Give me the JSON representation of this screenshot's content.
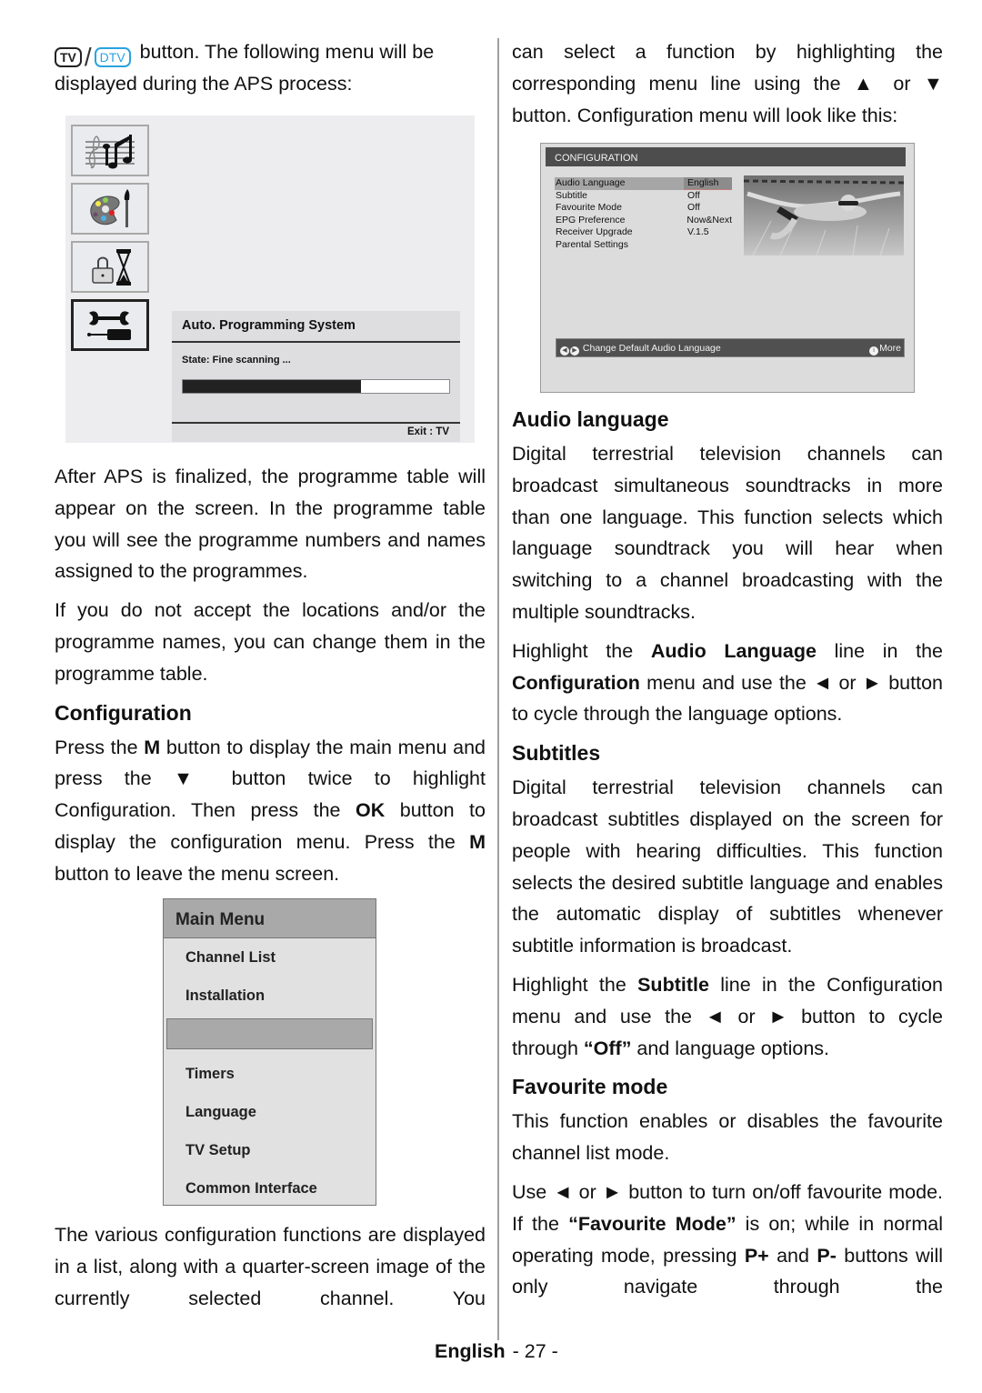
{
  "page": {
    "footer_language": "English",
    "footer_page": "- 27 -"
  },
  "left_column": {
    "intro_keys": {
      "tv": "TV",
      "slash": "/",
      "dtv": "DTV"
    },
    "intro_text": "button.  The following menu will be displayed during the APS process:",
    "aps_screen": {
      "icons": [
        "music-icon",
        "palette-icon",
        "lock-timer-icon",
        "tools-icon"
      ],
      "active_icon_index": 3,
      "dialog_title": "Auto. Programming System",
      "state_text": "State: Fine scanning ...",
      "progress_percent": 67,
      "exit_hint": "Exit : TV"
    },
    "para_after_aps": " After APS is finalized, the programme table will appear on the screen. In the programme table you will see the programme numbers and names assigned to the programmes.",
    "para_locations": "If you do not accept the locations and/or the programme names, you can change them in the programme table.",
    "config_heading": "Configuration",
    "config_para": {
      "t1": "Press the ",
      "b1": "M",
      "t2": " button to display the main menu and press the ▼ button twice to highlight Configuration. Then press the ",
      "b2": "OK",
      "t3": " button to display the configuration menu. Press the ",
      "b3": "M",
      "t4": " button to leave the menu screen."
    },
    "main_menu": {
      "title": "Main Menu",
      "items": [
        "Channel List",
        "Installation",
        "",
        "Timers",
        "Language",
        "TV Setup",
        "Common Interface"
      ],
      "selected_index": 2
    },
    "para_various": "The various configuration functions are displayed in a list, along with a quarter-screen image of the currently selected channel. You"
  },
  "right_column": {
    "para_select": "can select a function by highlighting the corresponding menu line using the ▲ or ▼ button. Configuration menu will look like this:",
    "config_screen": {
      "title": "CONFIGURATION",
      "rows": [
        {
          "label": "Audio Language",
          "value": "English"
        },
        {
          "label": "Subtitle",
          "value": "Off"
        },
        {
          "label": "Favourite Mode",
          "value": "Off"
        },
        {
          "label": "EPG Preference",
          "value": "Now&Next"
        },
        {
          "label": "Receiver Upgrade",
          "value": "V.1.5"
        },
        {
          "label": "Parental Settings",
          "value": ""
        }
      ],
      "selected_index": 0,
      "hint_text": "Change Default Audio Language",
      "more_label": "More",
      "preview_image": "swimmer-underwater-photo"
    },
    "audio_heading": "Audio language",
    "audio_para": "Digital terrestrial television channels can broadcast simultaneous soundtracks in more than one language. This function selects which language soundtrack you will hear when switching to a channel broadcasting with the multiple soundtracks.",
    "audio_para2": {
      "t1": "Highlight the ",
      "b1": "Audio Language",
      "t2": " line in the ",
      "b2": "Configuration",
      "t3": " menu and use the ◄ or ► button to cycle through the language options."
    },
    "subtitles_heading": "Subtitles",
    "subtitles_para": "Digital terrestrial television channels can broadcast subtitles displayed on the screen for people with hearing difficulties. This function selects the desired subtitle language and enables the automatic display of subtitles whenever subtitle information is broadcast.",
    "subtitles_para2": {
      "t1": "Highlight the ",
      "b1": "Subtitle",
      "t2": " line in the Configuration menu and use the ◄ or ► button to cycle through ",
      "b2": "“Off”",
      "t3": " and language options."
    },
    "favourite_heading": "Favourite mode",
    "favourite_para": "This function enables or disables the favourite channel list mode.",
    "favourite_para2": {
      "t1": "Use ◄ or ► button to turn on/off favourite mode. If the ",
      "b1": "“Favourite Mode”",
      "t2": " is on; while in normal operating mode, pressing ",
      "b2": "P+",
      "t3": " and ",
      "b3": "P-",
      "t4": " buttons will only navigate  through the"
    }
  }
}
